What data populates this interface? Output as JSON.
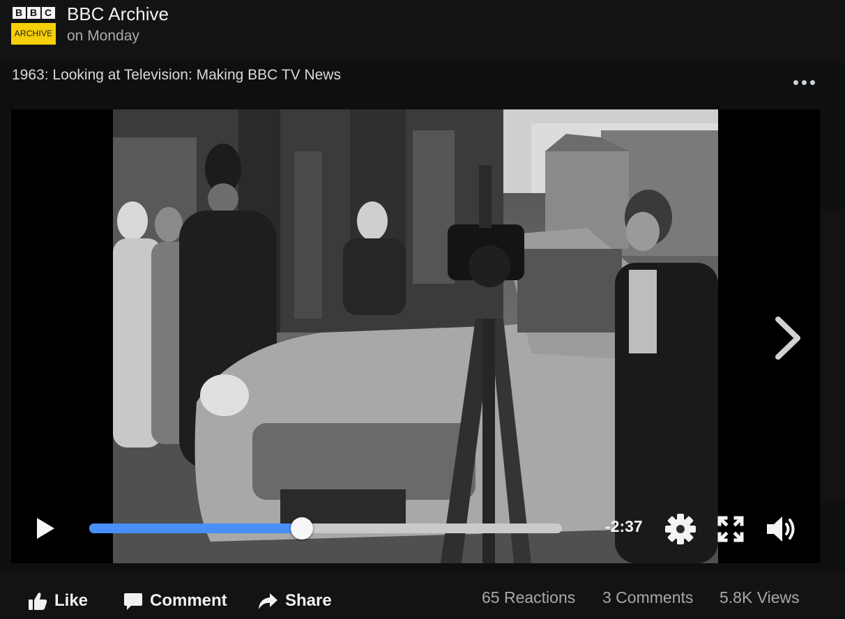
{
  "page": {
    "name": "BBC Archive",
    "time": "on Monday",
    "logo": {
      "top": [
        "B",
        "B",
        "C"
      ],
      "bottom": "ARCHIVE"
    }
  },
  "post": {
    "title": "1963: Looking at Television: Making BBC TV News"
  },
  "player": {
    "progress_fraction": 0.45,
    "time_remaining": "-2:37",
    "accent_color": "#4a8ef7"
  },
  "icons": {
    "more": "more-options-icon",
    "next": "chevron-right-icon",
    "play": "play-icon",
    "settings": "gear-icon",
    "fullscreen": "fullscreen-icon",
    "volume": "volume-icon",
    "like": "thumbs-up-icon",
    "comment": "comment-icon",
    "share": "share-icon"
  },
  "footer": {
    "like_label": "Like",
    "comment_label": "Comment",
    "share_label": "Share",
    "reactions": "65 Reactions",
    "comments": "3 Comments",
    "views": "5.8K Views"
  }
}
